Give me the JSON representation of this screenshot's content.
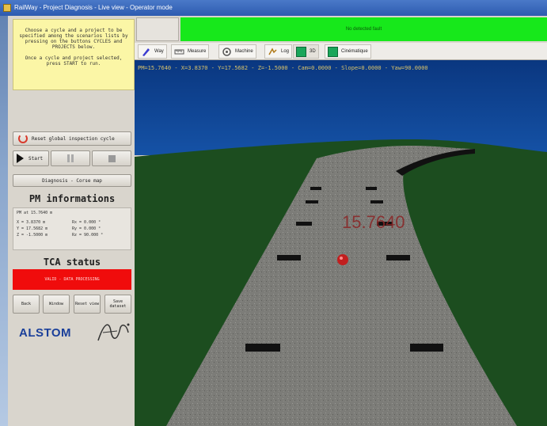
{
  "window": {
    "title": "RailWay - Project Diagnosis - Live view - Operator mode"
  },
  "left_panel": {
    "note_lines": [
      "Choose a cycle and a project to be specified among the scenarios lists by pressing on the buttons CYCLES and PROJECTS below.",
      "Once a cycle and project selected, press START to run."
    ],
    "reset_button": "Reset global inspection cycle",
    "play_button": "Start",
    "diagnosis_button": "Diagnosis - Corse map",
    "pm_title": "PM informations",
    "pm_head": "PM at 15.7640 m",
    "pm_values": [
      "X = 3.8370 m",
      "Rx = 0.000 °",
      "Y = 17.5682 m",
      "Ry = 0.000 °",
      "Z = -1.5000 m",
      "Rz = 90.000 °"
    ],
    "tca_title": "TCA status",
    "tca_text": "VALID - DATA PROCESSING",
    "small_buttons": [
      "Back",
      "Window",
      "Reset view",
      "Save dataset"
    ],
    "logo_text": "ALSTOM"
  },
  "status_bar": {
    "text": "No detected fault"
  },
  "tabs": [
    {
      "label": "Way",
      "icon": "pen-icon"
    },
    {
      "label": "Measure",
      "icon": "ruler-icon"
    },
    {
      "label": "Machine",
      "icon": "machine-icon"
    },
    {
      "label": "Log",
      "icon": "log-icon"
    },
    {
      "label": "3D",
      "icon": "cube-icon"
    },
    {
      "label": "Cinématique",
      "icon": "chart-icon"
    }
  ],
  "viewport": {
    "telemetry": "PM=15.7640 - X=3.8370 - Y=17.5682 - Z=-1.5000 - Cam=0.0000 - Slope=0.0000 - Yaw=90.0000",
    "distance_label": "15.7640"
  },
  "colors": {
    "sky": "#0d3f8a",
    "grass": "#1c4d1f",
    "road": "#7c7c78",
    "status_ok": "#17e81b",
    "tca_alert": "#f00c0c",
    "marker": "#c21f1f"
  }
}
